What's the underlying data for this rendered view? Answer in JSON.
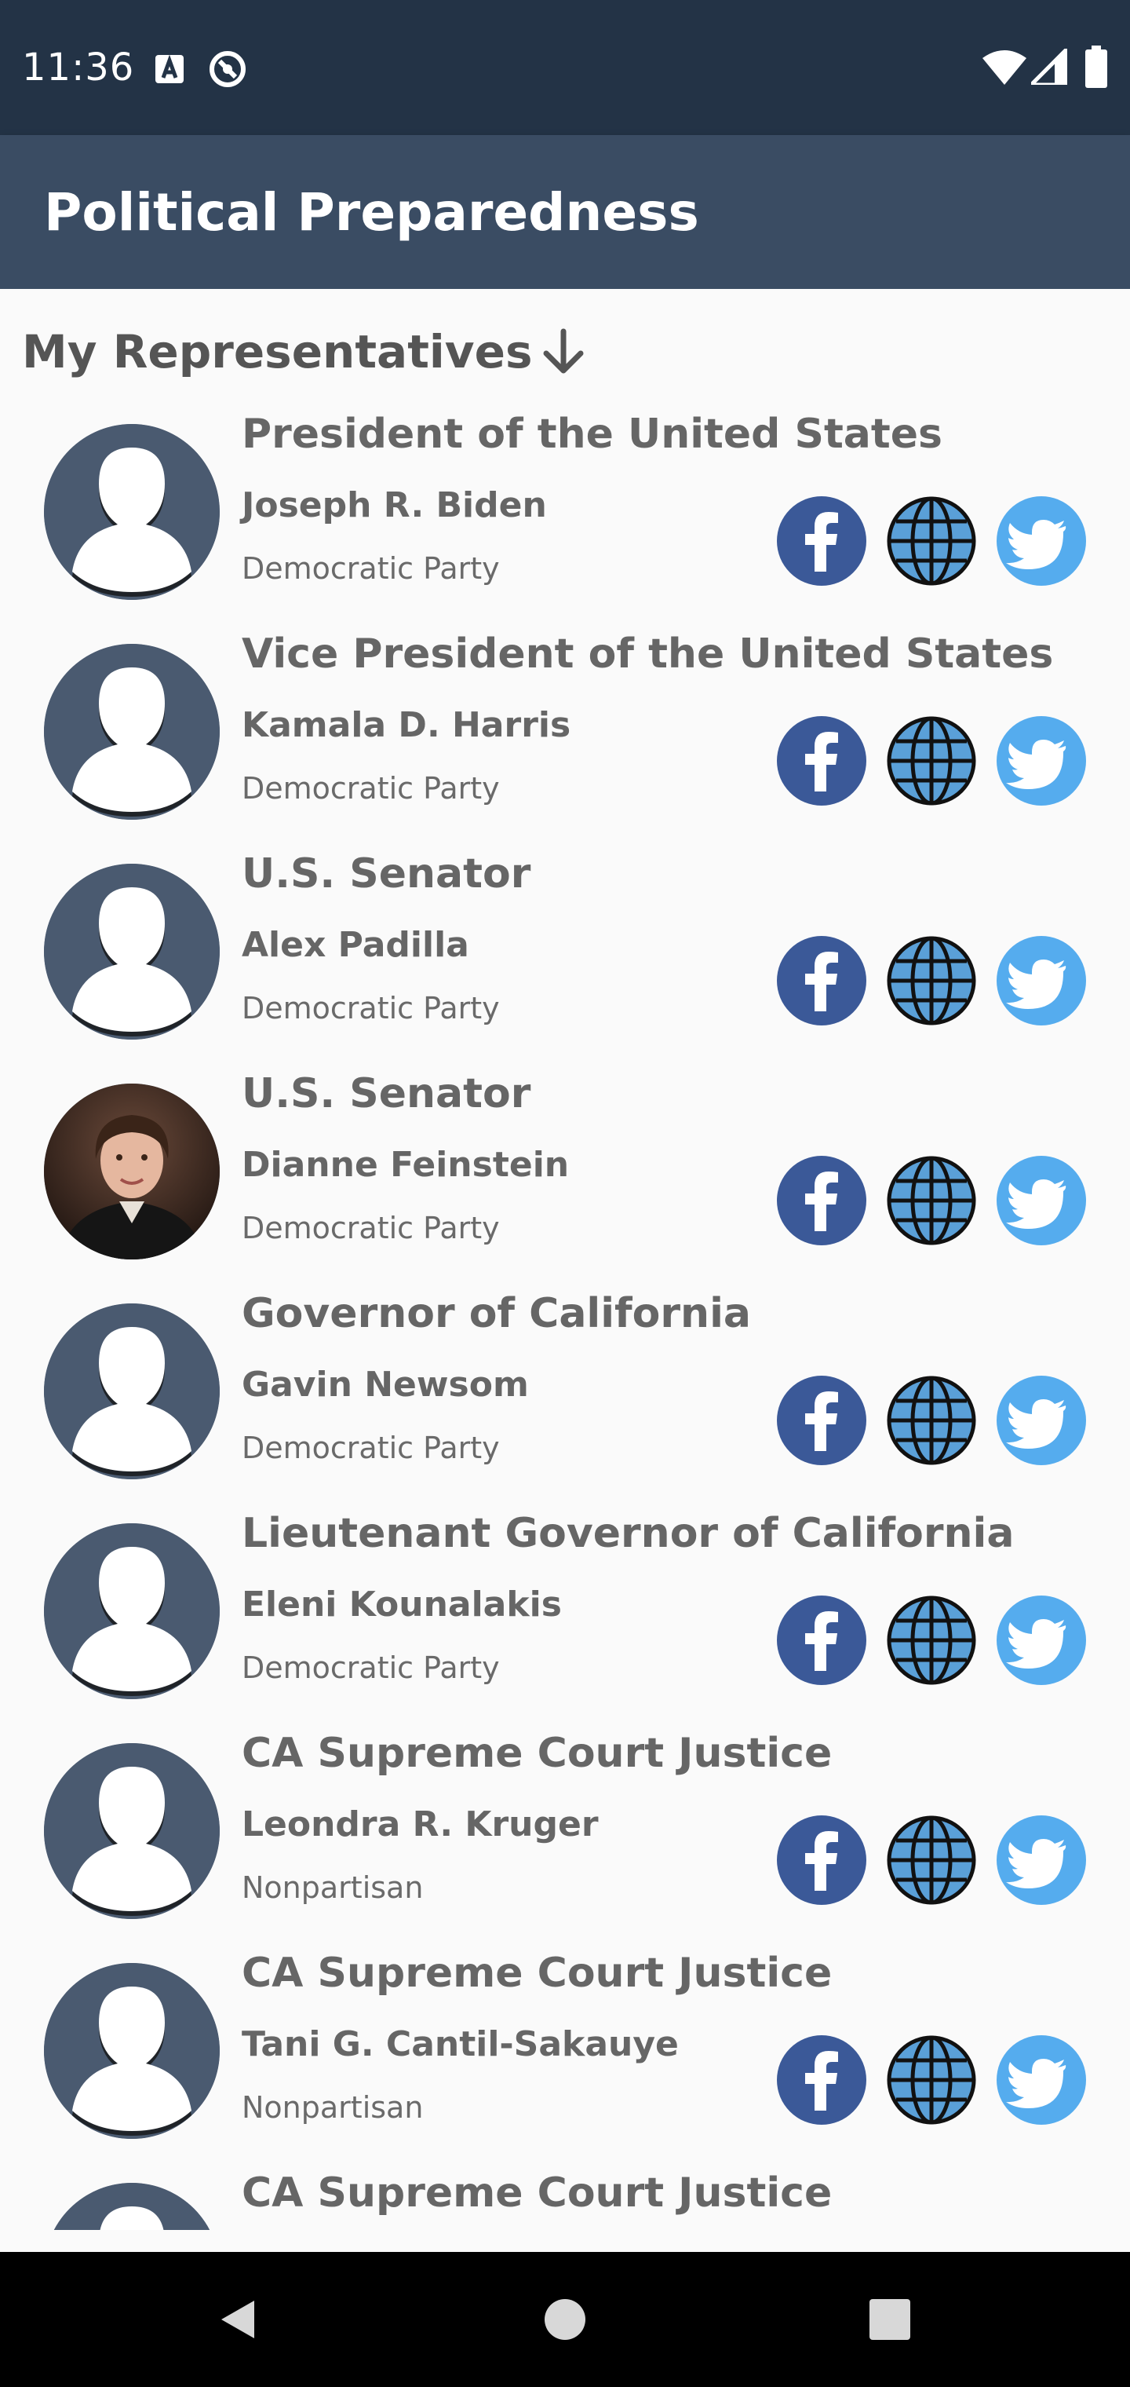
{
  "status_bar": {
    "time": "11:36",
    "icons": [
      "keyboard-a-icon",
      "sync-icon",
      "wifi-icon",
      "signal-icon",
      "battery-icon"
    ]
  },
  "app_bar": {
    "title": "Political Preparedness"
  },
  "section": {
    "title": "My Representatives",
    "sort_icon": "arrow-down-icon"
  },
  "representatives": [
    {
      "office": "President of the United States",
      "name": "Joseph R. Biden",
      "party": "Democratic Party",
      "photo": "placeholder"
    },
    {
      "office": "Vice President of the United States",
      "name": "Kamala D. Harris",
      "party": "Democratic Party",
      "photo": "placeholder"
    },
    {
      "office": "U.S. Senator",
      "name": "Alex Padilla",
      "party": "Democratic Party",
      "photo": "placeholder"
    },
    {
      "office": "U.S. Senator",
      "name": "Dianne Feinstein",
      "party": "Democratic Party",
      "photo": "portrait"
    },
    {
      "office": "Governor of California",
      "name": "Gavin Newsom",
      "party": "Democratic Party",
      "photo": "placeholder"
    },
    {
      "office": "Lieutenant Governor of California",
      "name": "Eleni Kounalakis",
      "party": "Democratic Party",
      "photo": "placeholder"
    },
    {
      "office": "CA Supreme Court Justice",
      "name": "Leondra R. Kruger",
      "party": "Nonpartisan",
      "photo": "placeholder"
    },
    {
      "office": "CA Supreme Court Justice",
      "name": "Tani G. Cantil-Sakauye",
      "party": "Nonpartisan",
      "photo": "placeholder"
    },
    {
      "office": "CA Supreme Court Justice",
      "name": "",
      "party": "",
      "photo": "placeholder"
    }
  ],
  "social_icons": [
    "facebook-icon",
    "website-globe-icon",
    "twitter-icon"
  ],
  "colors": {
    "status_bar": "#233346",
    "app_bar": "#3a4c63",
    "facebook": "#3b5998",
    "globe": "#5aa0d8",
    "twitter": "#55acee",
    "avatar_bg": "#4a5a70"
  },
  "nav_bar": {
    "buttons": [
      "back-icon",
      "home-icon",
      "recents-icon"
    ]
  }
}
